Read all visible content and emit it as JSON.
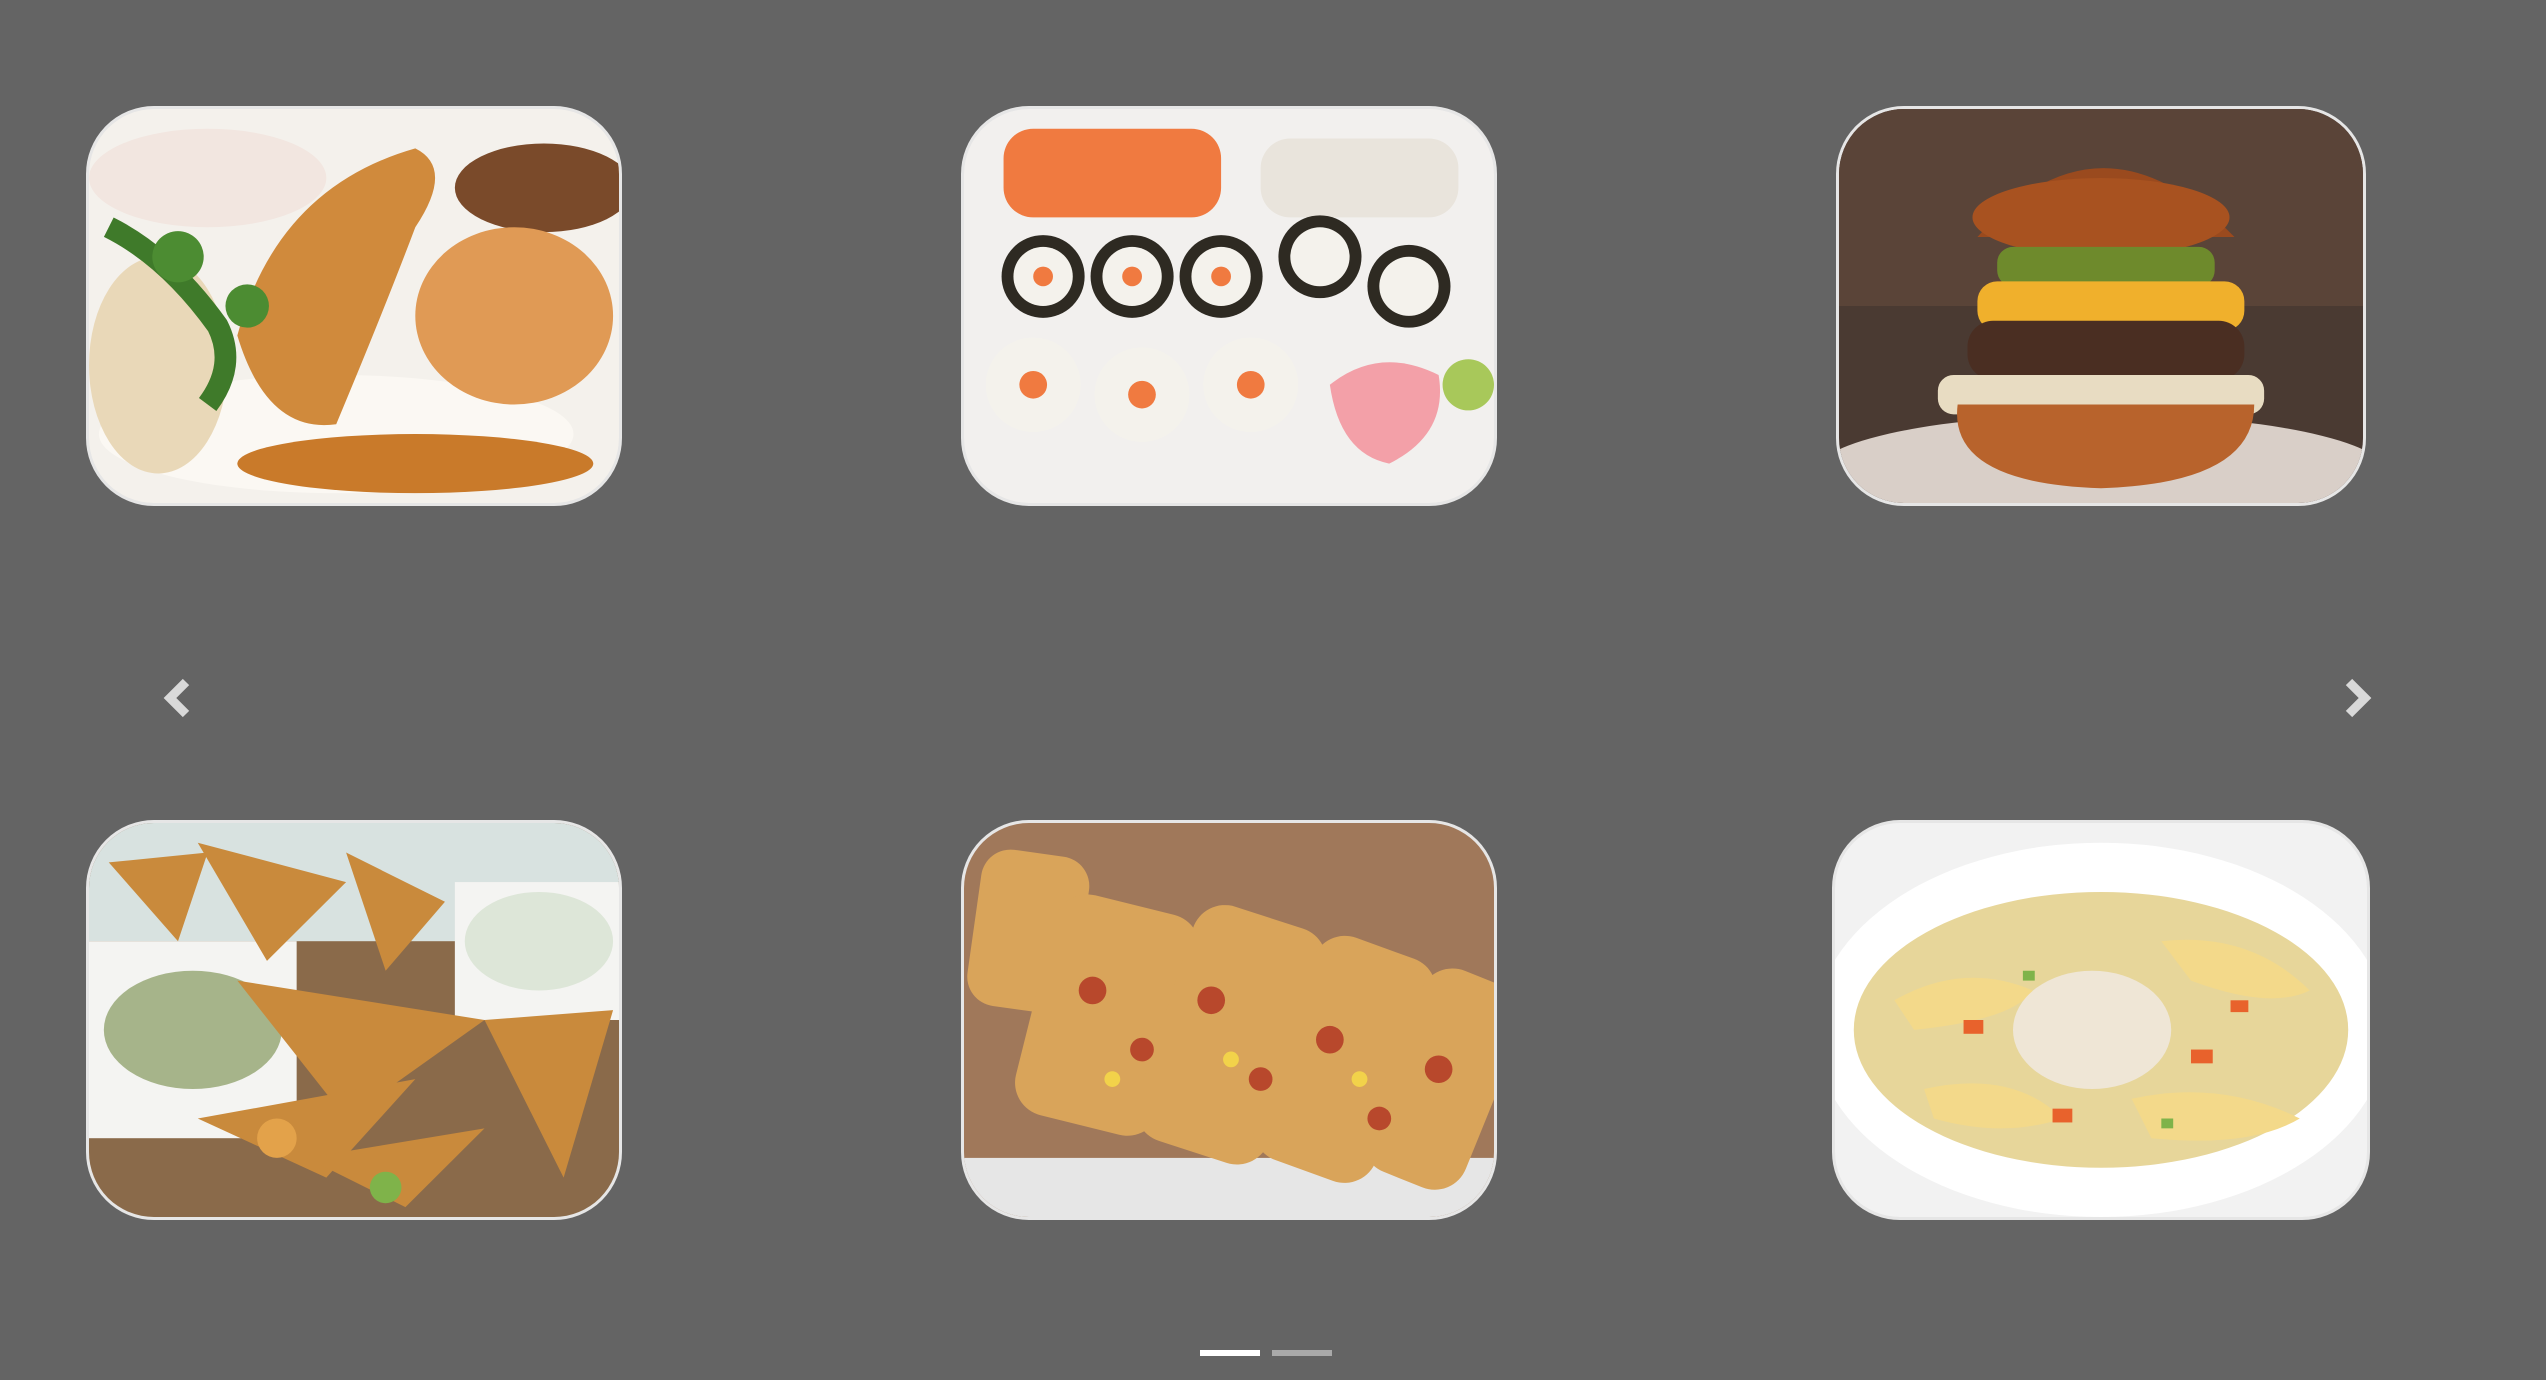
{
  "carousel": {
    "slides": [
      {
        "name": "chicken-dish-image"
      },
      {
        "name": "sushi-platter-image"
      },
      {
        "name": "burger-image"
      },
      {
        "name": "samosa-image"
      },
      {
        "name": "pizza-bread-image"
      },
      {
        "name": "chicken-noodle-soup-image"
      }
    ],
    "controls": {
      "prev_icon": "chevron-left-icon",
      "next_icon": "chevron-right-icon"
    },
    "indicators": {
      "count": 2,
      "active": 1
    }
  },
  "colors": {
    "background": "#646464",
    "card_border": "#e6e6e6",
    "indicator_active": "#ffffff",
    "indicator_inactive": "#a9a9a9",
    "arrow": "#d9d9d9"
  }
}
